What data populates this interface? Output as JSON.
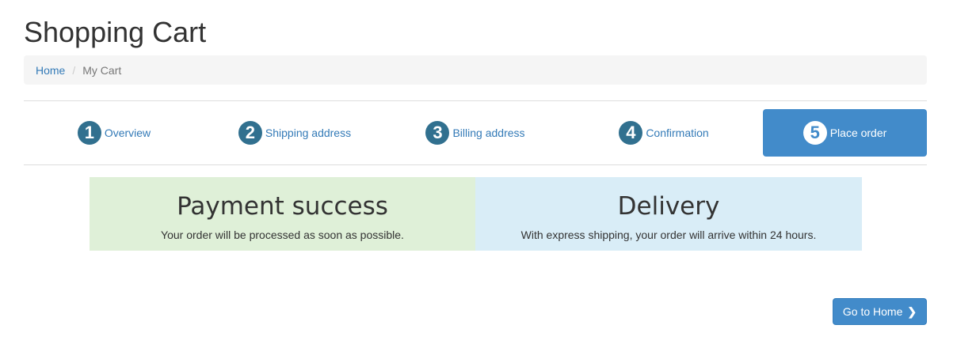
{
  "page": {
    "title": "Shopping Cart"
  },
  "breadcrumb": {
    "home": "Home",
    "separator": "/",
    "current": "My Cart"
  },
  "steps": [
    {
      "number": "1",
      "label": "Overview"
    },
    {
      "number": "2",
      "label": "Shipping address"
    },
    {
      "number": "3",
      "label": "Billing address"
    },
    {
      "number": "4",
      "label": "Confirmation"
    },
    {
      "number": "5",
      "label": "Place order"
    }
  ],
  "panels": {
    "payment": {
      "title": "Payment success",
      "text": "Your order will be processed as soon as possible."
    },
    "delivery": {
      "title": "Delivery",
      "text": "With express shipping, your order will arrive within 24 hours."
    }
  },
  "actions": {
    "go_home_label": "Go to Home",
    "go_home_icon": "chevron-right-icon"
  },
  "colors": {
    "accent": "#428bca",
    "step_number": "#31708f",
    "success_bg": "#dff0d8",
    "info_bg": "#d9edf7"
  }
}
